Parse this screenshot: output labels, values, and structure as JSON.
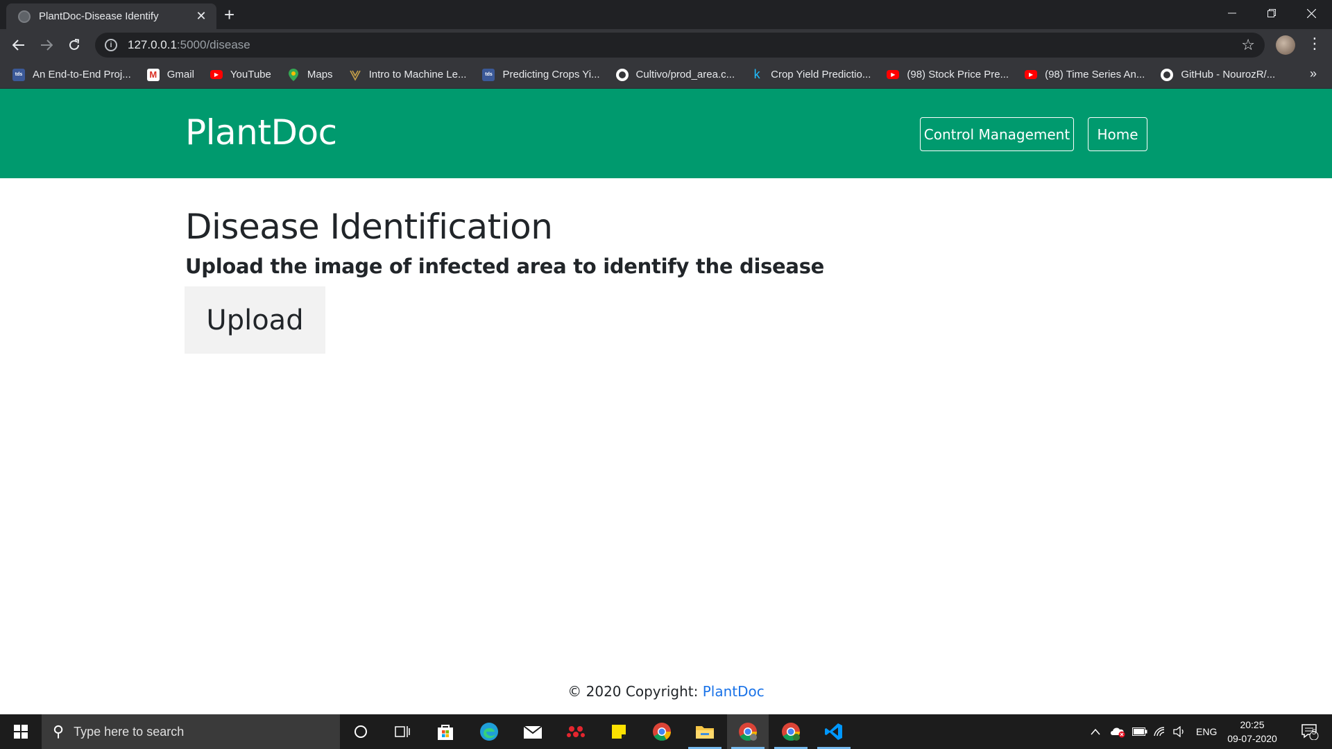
{
  "browser": {
    "tab_title": "PlantDoc-Disease Identify",
    "tab_close": "✕",
    "new_tab": "+",
    "url_host": "127.0.0.1",
    "url_path": ":5000/disease",
    "bookmarks": [
      {
        "label": "An End-to-End Proj...",
        "icon": "tds"
      },
      {
        "label": "Gmail",
        "icon": "gmail"
      },
      {
        "label": "YouTube",
        "icon": "youtube"
      },
      {
        "label": "Maps",
        "icon": "maps"
      },
      {
        "label": "Intro to Machine Le...",
        "icon": "udacity"
      },
      {
        "label": "Predicting Crops Yi...",
        "icon": "tds"
      },
      {
        "label": "Cultivo/prod_area.c...",
        "icon": "github"
      },
      {
        "label": "Crop Yield Predictio...",
        "icon": "kaggle"
      },
      {
        "label": "(98) Stock Price Pre...",
        "icon": "youtube"
      },
      {
        "label": "(98) Time Series An...",
        "icon": "youtube"
      },
      {
        "label": "GitHub - NourozR/...",
        "icon": "github"
      }
    ],
    "bookmarks_more": "»"
  },
  "navbar": {
    "brand": "PlantDoc",
    "links": [
      "Control Management",
      "Home"
    ],
    "color": "#009a6e"
  },
  "main": {
    "title": "Disease Identification",
    "subtitle": "Upload the image of infected area to identify the disease",
    "upload_label": "Upload"
  },
  "footer": {
    "copyright": "© 2020 Copyright: ",
    "link": "PlantDoc"
  },
  "taskbar": {
    "search_placeholder": "Type here to search",
    "lang": "ENG",
    "time": "20:25",
    "date": "09-07-2020",
    "notifications": "5"
  }
}
